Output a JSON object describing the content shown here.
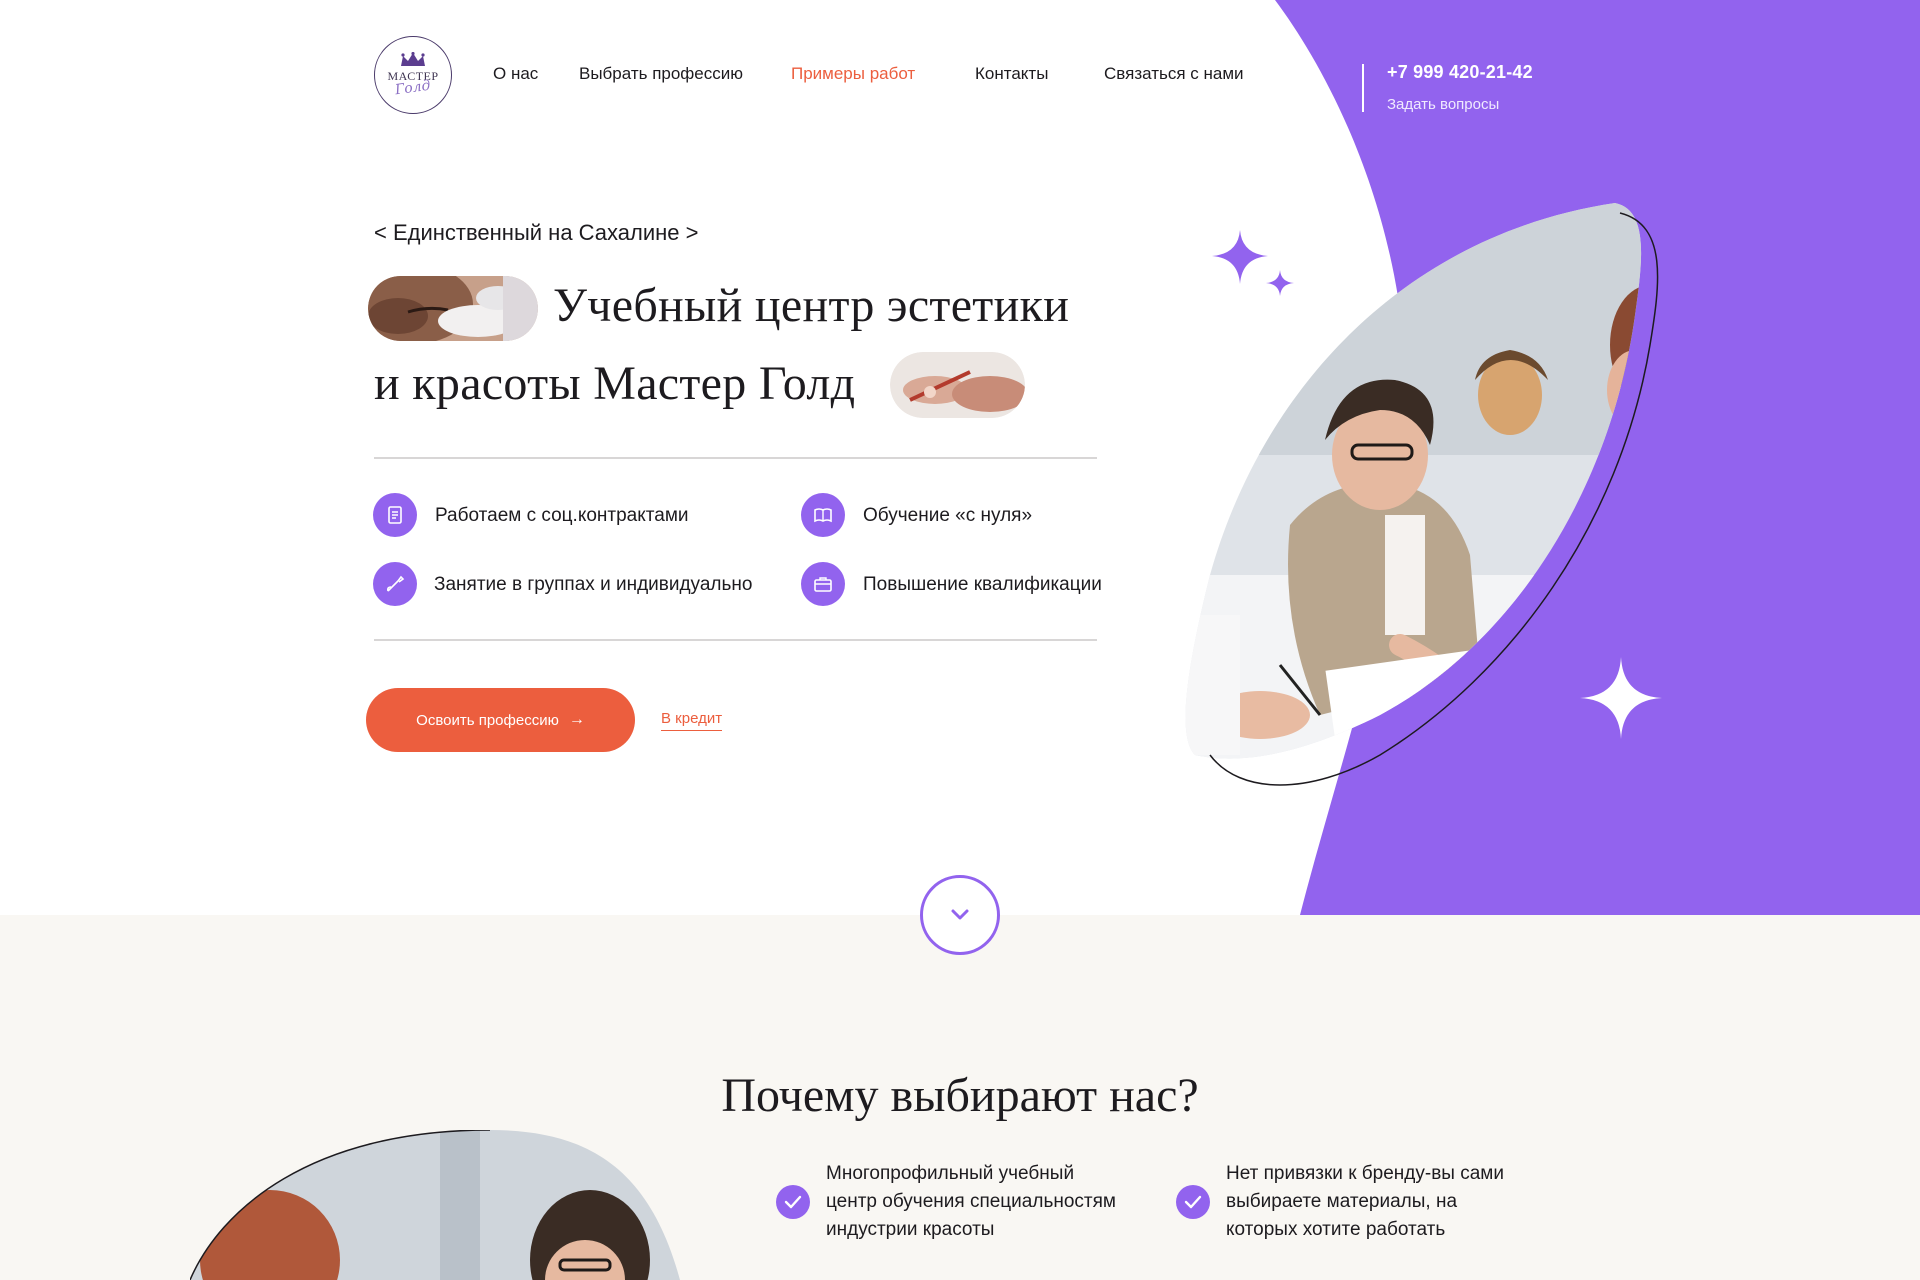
{
  "header": {
    "logo": {
      "line1": "МАСТЕР",
      "line2": "Голд"
    },
    "nav": [
      "О нас",
      "Выбрать профессию",
      "Примеры работ",
      "Контакты",
      "Связаться с нами"
    ],
    "phone": "+7 999 420-21-42",
    "ask": "Задать вопросы"
  },
  "hero": {
    "tagline": "< Единственный на Сахалине >",
    "title_line1": "Учебный центр эстетики",
    "title_line2": "и красоты Мастер Голд",
    "features": [
      {
        "icon": "document-icon",
        "text": "Работаем с соц.контрактами"
      },
      {
        "icon": "book-icon",
        "text": "Обучение «с нуля»"
      },
      {
        "icon": "brush-icon",
        "text": "Занятие в группах и индивидуально"
      },
      {
        "icon": "briefcase-icon",
        "text": "Повышение квалификации"
      }
    ],
    "cta": "Освоить профессию",
    "credit": "В кредит"
  },
  "why": {
    "title": "Почему выбирают нас?",
    "items": [
      {
        "lines": [
          "Многопрофильный учебный",
          "центр обучения специальностям",
          "индустрии красоты"
        ]
      },
      {
        "lines": [
          "Нет привязки к бренду-вы сами",
          "выбираете материалы, на",
          "которых хотите работать"
        ]
      }
    ]
  },
  "colors": {
    "purple": "#9263ee",
    "orange": "#ec5e3e",
    "beige": "#f9f7f3"
  }
}
